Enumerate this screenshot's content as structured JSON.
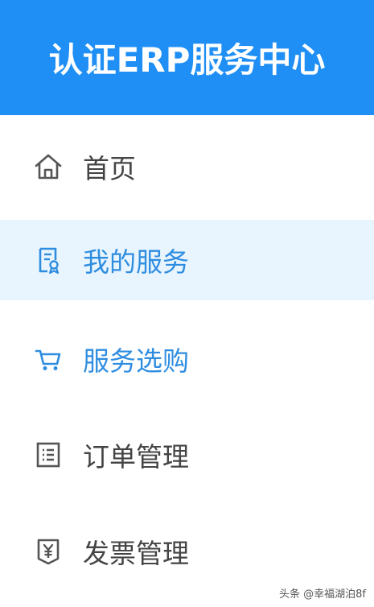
{
  "header": {
    "title": "认证ERP服务中心",
    "bg_color": "#1f8ff5"
  },
  "menu": {
    "items": [
      {
        "label": "首页",
        "icon": "home-icon",
        "state": "normal"
      },
      {
        "label": "我的服务",
        "icon": "service-document-icon",
        "state": "active"
      },
      {
        "label": "服务选购",
        "icon": "shopping-cart-icon",
        "state": "accent"
      },
      {
        "label": "订单管理",
        "icon": "order-list-icon",
        "state": "normal"
      },
      {
        "label": "发票管理",
        "icon": "invoice-yen-icon",
        "state": "normal"
      }
    ],
    "active_bg_color": "#e8f5fe",
    "accent_color": "#2f8de0",
    "text_color": "#444444"
  },
  "watermark": {
    "text": "头条 @幸福湖泊8f"
  }
}
